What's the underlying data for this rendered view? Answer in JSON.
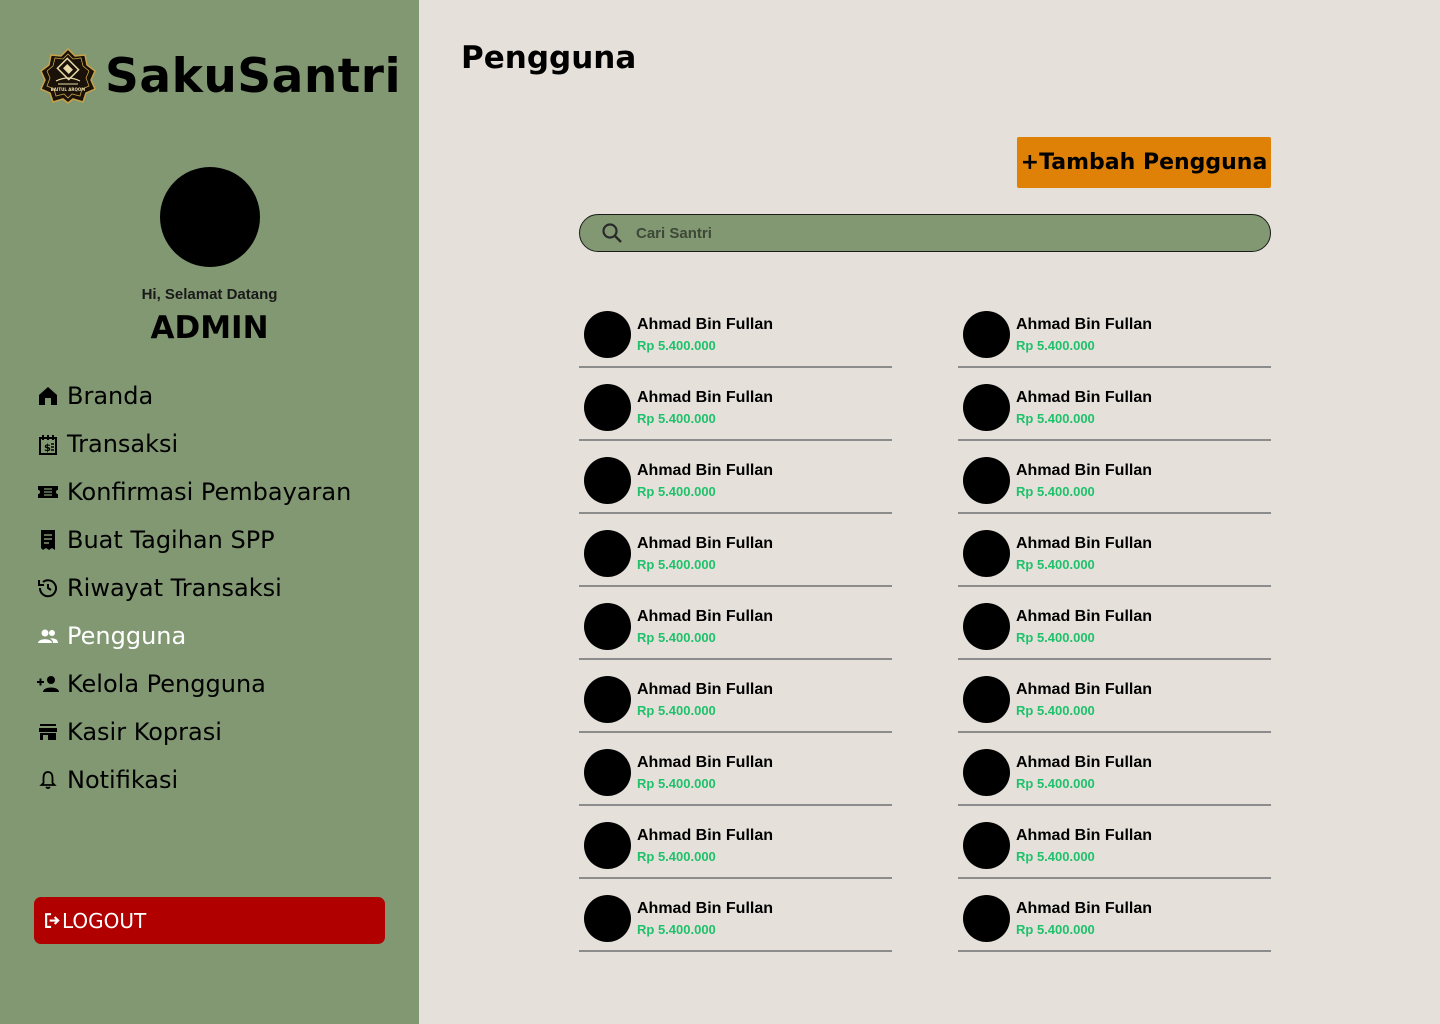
{
  "app": {
    "name": "SakuSantri",
    "logo_text": "BAITUL ARQOM"
  },
  "profile": {
    "greeting": "Hi, Selamat Datang",
    "role": "ADMIN"
  },
  "sidebar": {
    "items": [
      {
        "label": "Branda",
        "icon": "home-icon"
      },
      {
        "label": "Transaksi",
        "icon": "receipt-dollar-icon"
      },
      {
        "label": "Konfirmasi Pembayaran",
        "icon": "ticket-icon"
      },
      {
        "label": "Buat Tagihan SPP",
        "icon": "bill-icon"
      },
      {
        "label": "Riwayat Transaksi",
        "icon": "history-icon"
      },
      {
        "label": "Pengguna",
        "icon": "users-icon",
        "active": true
      },
      {
        "label": "Kelola Pengguna",
        "icon": "add-user-icon"
      },
      {
        "label": "Kasir Koprasi",
        "icon": "store-icon"
      },
      {
        "label": "Notifikasi",
        "icon": "bell-icon"
      }
    ],
    "logout_label": "LOGOUT"
  },
  "main": {
    "title": "Pengguna",
    "add_button_label": "+Tambah Pengguna",
    "search": {
      "placeholder": "Cari Santri",
      "value": ""
    },
    "users_left": [
      {
        "name": "Ahmad Bin Fullan",
        "amount": "Rp 5.400.000"
      },
      {
        "name": "Ahmad Bin Fullan",
        "amount": "Rp 5.400.000"
      },
      {
        "name": "Ahmad Bin Fullan",
        "amount": "Rp 5.400.000"
      },
      {
        "name": "Ahmad Bin Fullan",
        "amount": "Rp 5.400.000"
      },
      {
        "name": "Ahmad Bin Fullan",
        "amount": "Rp 5.400.000"
      },
      {
        "name": "Ahmad Bin Fullan",
        "amount": "Rp 5.400.000"
      },
      {
        "name": "Ahmad Bin Fullan",
        "amount": "Rp 5.400.000"
      },
      {
        "name": "Ahmad Bin Fullan",
        "amount": "Rp 5.400.000"
      },
      {
        "name": "Ahmad Bin Fullan",
        "amount": "Rp 5.400.000"
      }
    ],
    "users_right": [
      {
        "name": "Ahmad Bin Fullan",
        "amount": "Rp 5.400.000"
      },
      {
        "name": "Ahmad Bin Fullan",
        "amount": "Rp 5.400.000"
      },
      {
        "name": "Ahmad Bin Fullan",
        "amount": "Rp 5.400.000"
      },
      {
        "name": "Ahmad Bin Fullan",
        "amount": "Rp 5.400.000"
      },
      {
        "name": "Ahmad Bin Fullan",
        "amount": "Rp 5.400.000"
      },
      {
        "name": "Ahmad Bin Fullan",
        "amount": "Rp 5.400.000"
      },
      {
        "name": "Ahmad Bin Fullan",
        "amount": "Rp 5.400.000"
      },
      {
        "name": "Ahmad Bin Fullan",
        "amount": "Rp 5.400.000"
      },
      {
        "name": "Ahmad Bin Fullan",
        "amount": "Rp 5.400.000"
      }
    ]
  },
  "colors": {
    "sidebar_bg": "#819872",
    "content_bg": "#e5e1da",
    "accent_orange": "#df8106",
    "logout_red": "#b00000",
    "amount_green": "#1fc16b"
  }
}
